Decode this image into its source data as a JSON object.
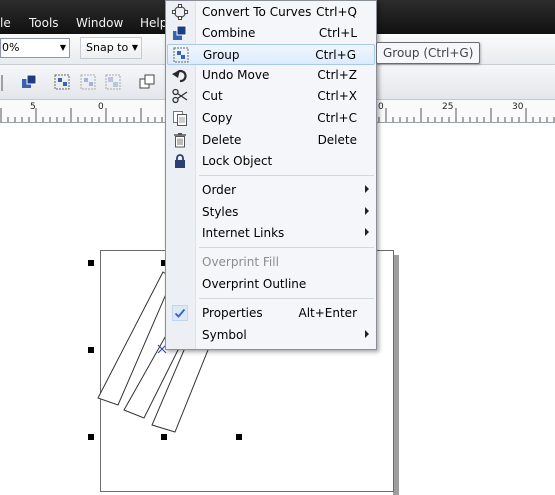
{
  "menubar": {
    "items": [
      "le",
      "Tools",
      "Window",
      "Help"
    ]
  },
  "propbar": {
    "zoom_value": "0%",
    "snap_label": "Snap to"
  },
  "ruler": {
    "labels": [
      "5",
      "0",
      "0",
      "25",
      "30"
    ]
  },
  "context_menu": {
    "items": [
      {
        "label": "Convert To Curves",
        "shortcut": "Ctrl+Q",
        "icon": "convert-to-curves-icon"
      },
      {
        "label": "Combine",
        "shortcut": "Ctrl+L",
        "icon": "combine-icon"
      },
      {
        "label": "Group",
        "shortcut": "Ctrl+G",
        "icon": "group-icon",
        "highlighted": true
      },
      {
        "label": "Undo Move",
        "shortcut": "Ctrl+Z",
        "icon": "undo-icon"
      },
      {
        "label": "Cut",
        "shortcut": "Ctrl+X",
        "icon": "scissors-icon"
      },
      {
        "label": "Copy",
        "shortcut": "Ctrl+C",
        "icon": "copy-icon"
      },
      {
        "label": "Delete",
        "shortcut": "Delete",
        "icon": "trash-icon"
      },
      {
        "label": "Lock Object",
        "shortcut": "",
        "icon": "lock-icon"
      },
      {
        "label": "Order",
        "submenu": true
      },
      {
        "label": "Styles",
        "submenu": true
      },
      {
        "label": "Internet Links",
        "submenu": true
      },
      {
        "label": "Overprint Fill",
        "disabled": true
      },
      {
        "label": "Overprint Outline"
      },
      {
        "label": "Properties",
        "shortcut": "Alt+Enter",
        "icon": "checkmark-icon",
        "checked": true
      },
      {
        "label": "Symbol",
        "submenu": true
      }
    ]
  },
  "tooltip": {
    "text": "Group (Ctrl+G)"
  },
  "colors": {
    "menubar": "#1e1e1e",
    "highlight_border": "#a8c8ee",
    "menu_bg": "#f4f6f9",
    "icon_blue": "#3a62b4"
  }
}
